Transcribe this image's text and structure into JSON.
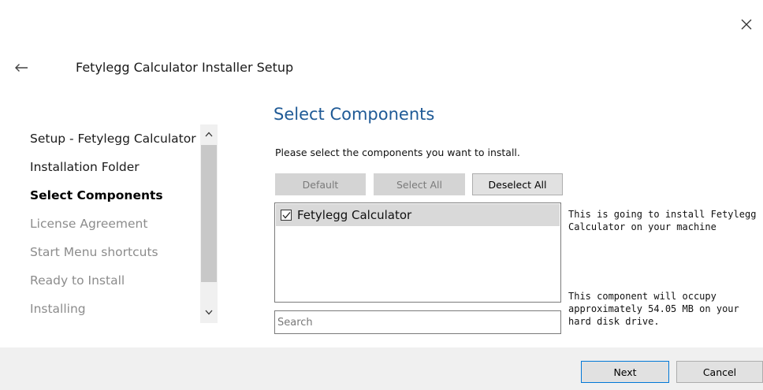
{
  "window": {
    "title": "Fetylegg Calculator Installer Setup",
    "close_icon": "close-icon",
    "back_icon": "back-arrow-icon"
  },
  "steps": [
    {
      "label": "Setup - Fetylegg Calculator",
      "state": "done"
    },
    {
      "label": "Installation Folder",
      "state": "done"
    },
    {
      "label": "Select Components",
      "state": "current"
    },
    {
      "label": "License Agreement",
      "state": "pending"
    },
    {
      "label": "Start Menu shortcuts",
      "state": "pending"
    },
    {
      "label": "Ready to Install",
      "state": "pending"
    },
    {
      "label": "Installing",
      "state": "pending"
    }
  ],
  "page": {
    "heading": "Select Components",
    "description": "Please select the components you want to install."
  },
  "selection_buttons": {
    "default_label": "Default",
    "select_all_label": "Select All",
    "deselect_all_label": "Deselect All"
  },
  "components": [
    {
      "label": "Fetylegg Calculator",
      "checked": true
    }
  ],
  "search": {
    "placeholder": "Search",
    "value": ""
  },
  "info": {
    "description": "This is going to install Fetylegg Calculator on your machine",
    "size": "This component will occupy approximately 54.05 MB on your hard disk drive."
  },
  "footer": {
    "next_label": "Next",
    "cancel_label": "Cancel"
  },
  "colors": {
    "heading": "#1f5a96",
    "primary_border": "#0078d7",
    "footer_bg": "#f0f0f0",
    "selected_row": "#d9d9d9"
  }
}
